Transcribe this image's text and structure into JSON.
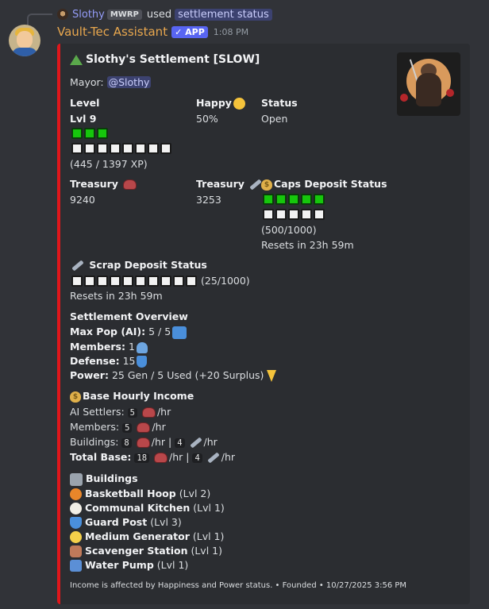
{
  "reply": {
    "username": "Slothy",
    "tag": "MWRP",
    "used": "used",
    "command": "settlement status"
  },
  "message": {
    "bot_name": "Vault-Tec Assistant",
    "app_badge": "✓ APP",
    "time": "1:08 PM"
  },
  "embed": {
    "accent_color": "#e0161b",
    "title": "Slothy's Settlement [SLOW]",
    "mayor_label": "Mayor:",
    "mayor": "@Slothy",
    "level": {
      "name": "Level",
      "value": "Lvl 9",
      "filled": 3,
      "empty": 8,
      "xp": "(445 / 1397 XP)"
    },
    "happy": {
      "name": "Happy",
      "value": "50%"
    },
    "status": {
      "name": "Status",
      "value": "Open"
    },
    "treasury_caps": {
      "name": "Treasury",
      "value": "9240"
    },
    "treasury_scrap": {
      "name": "Treasury",
      "value": "3253"
    },
    "caps_deposit": {
      "name": "Caps Deposit Status",
      "filled": 5,
      "empty": 5,
      "progress": "(500/1000)",
      "reset": "Resets in 23h 59m"
    },
    "scrap_deposit": {
      "name": "Scrap Deposit Status",
      "filled": 0,
      "empty": 10,
      "progress": "(25/1000)",
      "reset": "Resets in 23h 59m"
    },
    "overview": {
      "title": "Settlement Overview",
      "max_pop_label": "Max Pop (AI):",
      "max_pop": "5 / 5",
      "members_label": "Members:",
      "members": "1",
      "defense_label": "Defense:",
      "defense": "15",
      "power_label": "Power:",
      "power": "25 Gen / 5 Used (+20 Surplus)"
    },
    "income": {
      "title": "Base Hourly Income",
      "ai_label": "AI Settlers:",
      "ai_value": "5",
      "per_hr": "/hr",
      "members_label": "Members:",
      "members_value": "5",
      "buildings_label": "Buildings:",
      "buildings_caps": "8",
      "buildings_scrap": "4",
      "sep": "|",
      "total_label": "Total Base:",
      "total_caps": "18",
      "total_scrap": "4"
    },
    "buildings": {
      "title": "Buildings",
      "items": [
        {
          "name": "Basketball Hoop",
          "level": "(Lvl 2)",
          "color": "#e8862a"
        },
        {
          "name": "Communal Kitchen",
          "level": "(Lvl 1)",
          "color": "#f2efe6"
        },
        {
          "name": "Guard Post",
          "level": "(Lvl 3)",
          "color": "#4a8fdb"
        },
        {
          "name": "Medium Generator",
          "level": "(Lvl 1)",
          "color": "#f5d04a"
        },
        {
          "name": "Scavenger Station",
          "level": "(Lvl 1)",
          "color": "#c07a5a"
        },
        {
          "name": "Water Pump",
          "level": "(Lvl 1)",
          "color": "#5b8fd6"
        }
      ]
    },
    "footer": "Income is affected by Happiness and Power status. • Founded • 10/27/2025 3:56 PM"
  }
}
